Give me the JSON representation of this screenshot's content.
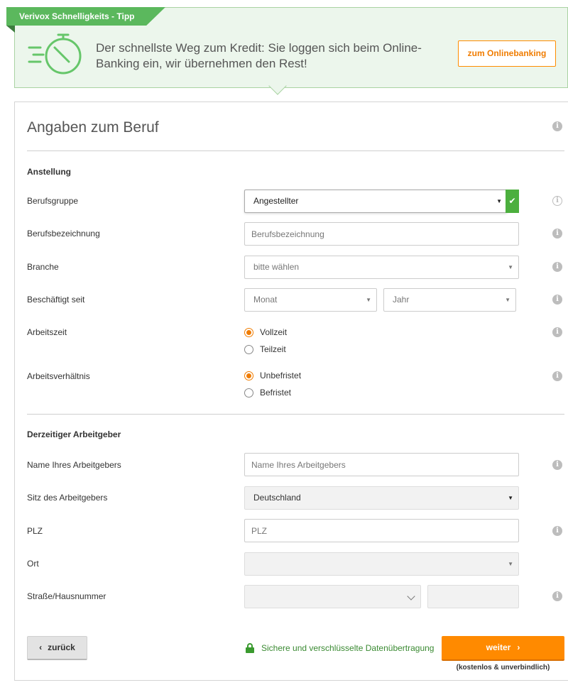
{
  "tip": {
    "ribbon": "Verivox Schnelligkeits - Tipp",
    "text": "Der schnellste Weg zum Kredit: Sie loggen sich beim Online-Banking ein, wir übernehmen den Rest!",
    "button": "zum Onlinebanking"
  },
  "form": {
    "title": "Angaben zum Beruf",
    "section_employment": "Anstellung",
    "section_employer": "Derzeitiger Arbeitgeber",
    "berufsgruppe": {
      "label": "Berufsgruppe",
      "value": "Angestellter"
    },
    "berufsbezeichnung": {
      "label": "Berufsbezeichnung",
      "placeholder": "Berufsbezeichnung"
    },
    "branche": {
      "label": "Branche",
      "value": "bitte wählen"
    },
    "beschaeftigt_seit": {
      "label": "Beschäftigt seit",
      "month": "Monat",
      "year": "Jahr"
    },
    "arbeitszeit": {
      "label": "Arbeitszeit",
      "options": [
        "Vollzeit",
        "Teilzeit"
      ],
      "selected": "Vollzeit"
    },
    "arbeitsverhaeltnis": {
      "label": "Arbeitsverhältnis",
      "options": [
        "Unbefristet",
        "Befristet"
      ],
      "selected": "Unbefristet"
    },
    "arbeitgeber_name": {
      "label": "Name Ihres Arbeitgebers",
      "placeholder": "Name Ihres Arbeitgebers"
    },
    "arbeitgeber_sitz": {
      "label": "Sitz des Arbeitgebers",
      "value": "Deutschland"
    },
    "plz": {
      "label": "PLZ",
      "placeholder": "PLZ"
    },
    "ort": {
      "label": "Ort",
      "value": ""
    },
    "strasse": {
      "label": "Straße/Hausnummer",
      "street": "",
      "number": ""
    }
  },
  "footer": {
    "back": "zurück",
    "secure": "Sichere und verschlüsselte Datenübertragung",
    "next": "weiter",
    "next_note": "(kostenlos & unverbindlich)"
  },
  "icons": {
    "info": "info-icon",
    "check": "checkmark-icon",
    "lock": "lock-icon",
    "stopwatch": "stopwatch-icon"
  },
  "colors": {
    "accent_orange": "#ff8a00",
    "tip_green": "#5bb85d",
    "tip_background": "#ecf6ec",
    "success_green": "#4caf3e"
  }
}
